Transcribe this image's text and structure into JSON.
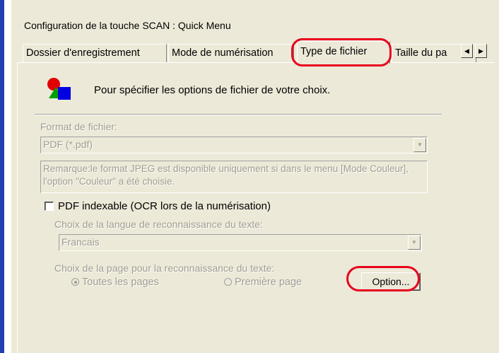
{
  "dialog": {
    "title": "Configuration de la touche SCAN : Quick Menu"
  },
  "tabs": [
    {
      "label": "Dossier d'enregistrement"
    },
    {
      "label": "Mode de numérisation"
    },
    {
      "label": "Type de fichier",
      "selected": true
    },
    {
      "label": "Taille du pa"
    }
  ],
  "tab_scroll": {
    "left_icon": "arrow-left-icon",
    "right_icon": "arrow-right-icon"
  },
  "panel": {
    "header_text": "Pour spécifier les options de fichier de votre choix.",
    "header_icon": "file-type-icon",
    "format_label": "Format de fichier:",
    "format_value": "PDF (*.pdf)",
    "note": "Remarque:le format JPEG est disponible uniquement si dans le menu [Mode Couleur], l'option \"Couleur\" a été choisie.",
    "ocr_checkbox_label": "PDF indexable (OCR lors de la numérisation)",
    "ocr_checked": false,
    "lang_label": "Choix de la langue de reconnaissance du texte:",
    "lang_value": "Francais",
    "page_label": "Choix de la page pour la reconnaissance du texte:",
    "radio_all": "Toutes les pages",
    "radio_first": "Première page",
    "radio_selected": "all",
    "option_button": "Option..."
  },
  "colors": {
    "highlight": "#e8001c",
    "window_bg": "#ece9d8",
    "disabled_text": "#a09c90",
    "left_bar": "#1f3fb2"
  }
}
